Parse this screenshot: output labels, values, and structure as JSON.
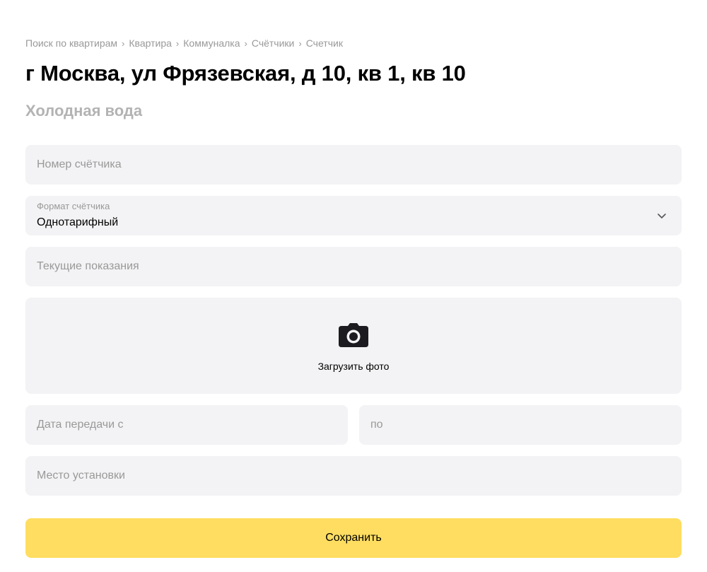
{
  "breadcrumbs": [
    {
      "label": "Поиск по квартирам"
    },
    {
      "label": "Квартира"
    },
    {
      "label": "Коммуналка"
    },
    {
      "label": "Счётчики"
    },
    {
      "label": "Счетчик"
    }
  ],
  "breadcrumb_separator": "›",
  "page": {
    "title": "г Москва, ул Фрязевская, д 10, кв 1, кв 10",
    "subtitle": "Холодная вода"
  },
  "form": {
    "meter_number": {
      "placeholder": "Номер счётчика",
      "value": ""
    },
    "meter_format": {
      "label": "Формат счётчика",
      "value": "Однотарифный"
    },
    "current_reading": {
      "placeholder": "Текущие показания",
      "value": ""
    },
    "photo_upload": {
      "label": "Загрузить фото",
      "icon": "camera-icon"
    },
    "date_from": {
      "placeholder": "Дата передачи с",
      "value": ""
    },
    "date_to": {
      "placeholder": "по",
      "value": ""
    },
    "install_location": {
      "placeholder": "Место установки",
      "value": ""
    },
    "save_label": "Сохранить"
  },
  "colors": {
    "field_bg": "#f3f3f5",
    "accent": "#ffdd60",
    "muted_text": "#999999"
  }
}
